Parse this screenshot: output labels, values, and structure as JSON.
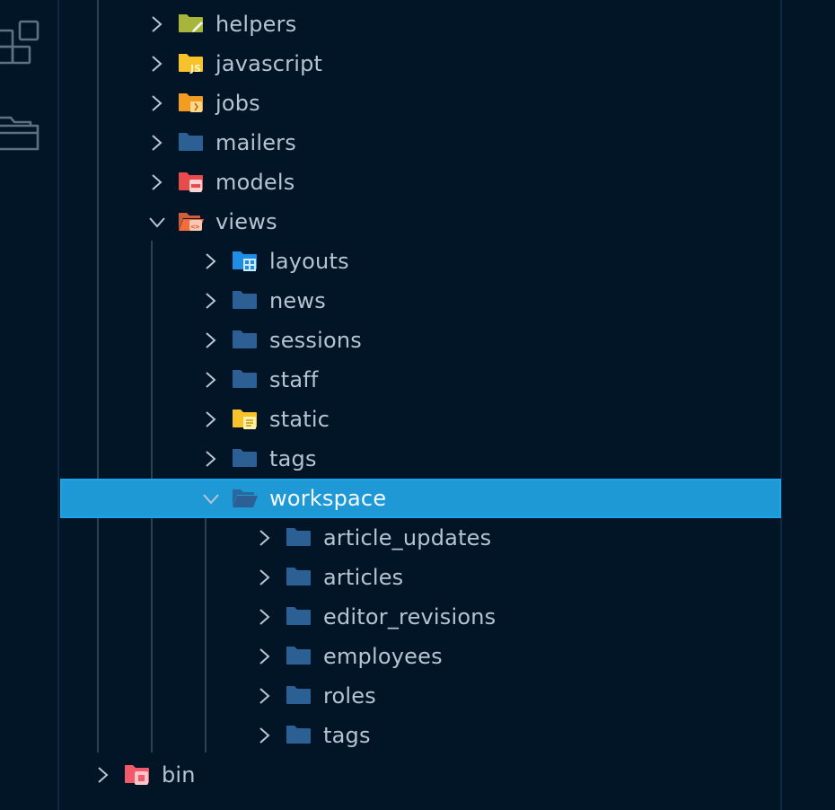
{
  "tree": [
    {
      "label": "helpers",
      "expanded": false,
      "icon": "folder-helpers-icon",
      "color": "#a7b63a"
    },
    {
      "label": "javascript",
      "expanded": false,
      "icon": "folder-javascript-icon",
      "color": "#f7c22a"
    },
    {
      "label": "jobs",
      "expanded": false,
      "icon": "folder-jobs-icon",
      "color": "#f39c22"
    },
    {
      "label": "mailers",
      "expanded": false,
      "icon": "folder-icon",
      "color": "#2c5f93"
    },
    {
      "label": "models",
      "expanded": false,
      "icon": "folder-models-icon",
      "color": "#e84b4b"
    },
    {
      "label": "views",
      "expanded": true,
      "icon": "folder-views-open-icon",
      "color": "#f36c3c"
    },
    {
      "label": "layouts",
      "expanded": false,
      "icon": "folder-layouts-icon",
      "color": "#1f8ce6"
    },
    {
      "label": "news",
      "expanded": false,
      "icon": "folder-icon",
      "color": "#2c5f93"
    },
    {
      "label": "sessions",
      "expanded": false,
      "icon": "folder-icon",
      "color": "#2c5f93"
    },
    {
      "label": "staff",
      "expanded": false,
      "icon": "folder-icon",
      "color": "#2c5f93"
    },
    {
      "label": "static",
      "expanded": false,
      "icon": "folder-static-icon",
      "color": "#f7c22a"
    },
    {
      "label": "tags",
      "expanded": false,
      "icon": "folder-icon",
      "color": "#2c5f93"
    },
    {
      "label": "workspace",
      "expanded": true,
      "selected": true,
      "icon": "folder-open-icon",
      "color": "#2c5f93"
    },
    {
      "label": "article_updates",
      "expanded": false,
      "icon": "folder-icon",
      "color": "#2c5f93"
    },
    {
      "label": "articles",
      "expanded": false,
      "icon": "folder-icon",
      "color": "#2c5f93"
    },
    {
      "label": "editor_revisions",
      "expanded": false,
      "icon": "folder-icon",
      "color": "#2c5f93"
    },
    {
      "label": "employees",
      "expanded": false,
      "icon": "folder-icon",
      "color": "#2c5f93"
    },
    {
      "label": "roles",
      "expanded": false,
      "icon": "folder-icon",
      "color": "#2c5f93"
    },
    {
      "label": "tags",
      "expanded": false,
      "icon": "folder-icon",
      "color": "#2c5f93"
    },
    {
      "label": "bin",
      "expanded": false,
      "icon": "folder-bin-icon",
      "color": "#f05a6a"
    }
  ],
  "activity_icons": [
    "extensions-icon",
    "explorer-icon"
  ]
}
